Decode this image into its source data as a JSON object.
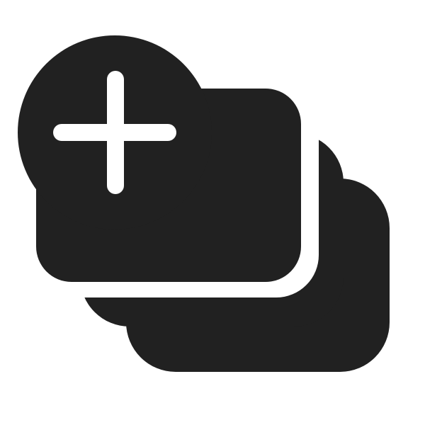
{
  "icon": {
    "name": "add-card-stack-icon",
    "glyph": "plus-in-circle over stacked cards",
    "foreground": "#212121",
    "background": "#ffffff"
  }
}
